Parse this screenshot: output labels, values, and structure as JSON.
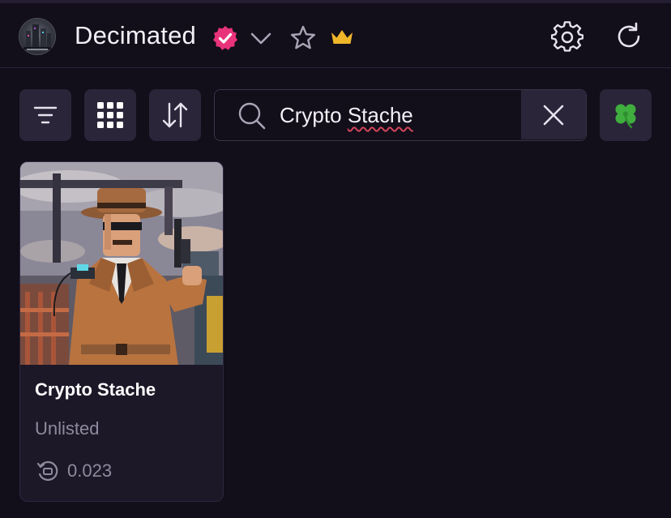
{
  "header": {
    "collection_name": "Decimated",
    "icons": {
      "avatar": "collection-avatar",
      "verified": "verified-badge-icon",
      "dropdown": "chevron-down-icon",
      "favorite": "star-icon",
      "premium": "crown-icon",
      "settings": "gear-icon",
      "refresh": "refresh-icon"
    }
  },
  "toolbar": {
    "buttons": [
      "filter-icon",
      "grid-icon",
      "sort-icon",
      "clover-icon"
    ],
    "search": {
      "value_word1": "Crypto ",
      "value_word2": "Stache"
    }
  },
  "results": [
    {
      "title": "Crypto Stache",
      "status": "Unlisted",
      "rarity": "0.023"
    }
  ],
  "colors": {
    "background": "#120e1a",
    "button": "#2a2538",
    "card": "#1c1827",
    "verified": "#e8337a",
    "crown": "#f0b62a",
    "muted_text": "#8f8a9e"
  }
}
